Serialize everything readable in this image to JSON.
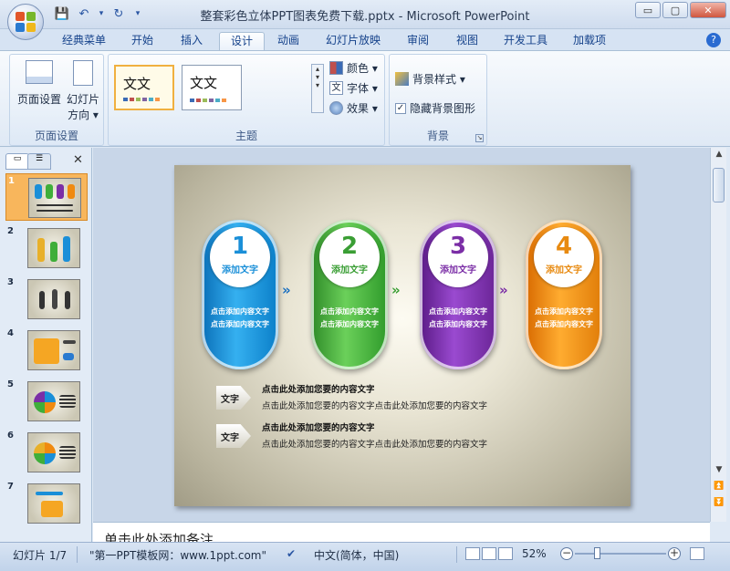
{
  "window": {
    "title": "整套彩色立体PPT图表免费下载.pptx - Microsoft PowerPoint",
    "controls": [
      "▭",
      "▢",
      "✕"
    ]
  },
  "qat": {
    "save": "💾",
    "undo": "↶",
    "undo_arrow": "▾",
    "redo": "↻",
    "custom": "▾"
  },
  "tabs": [
    "经典菜单",
    "开始",
    "插入",
    "设计",
    "动画",
    "幻灯片放映",
    "审阅",
    "视图",
    "开发工具",
    "加载项"
  ],
  "active_tab": "设计",
  "help": "?",
  "ribbon": {
    "page_setup": {
      "page_setup_btn": "页面设置",
      "orientation_btn_l1": "幻灯片",
      "orientation_btn_l2": "方向 ▾",
      "label": "页面设置"
    },
    "themes": {
      "thumb1_text": "文文",
      "thumb2_text": "文文",
      "colors": "颜色 ▾",
      "fonts": "字体 ▾",
      "effects": "效果 ▾",
      "label": "主题"
    },
    "background": {
      "styles": "背景样式 ▾",
      "hide_graphics": "隐藏背景图形",
      "label": "背景"
    }
  },
  "slide_pane": {
    "slides": [
      "1",
      "2",
      "3",
      "4",
      "5",
      "6",
      "7"
    ],
    "active": 1,
    "close": "✕"
  },
  "slide": {
    "steps": [
      {
        "num": "1",
        "label": "添加文字",
        "body1": "点击添加内容文字",
        "body2": "点击添加内容文字",
        "color": "#1a8fd8",
        "num_color": "#1a8fd8"
      },
      {
        "num": "2",
        "label": "添加文字",
        "body1": "点击添加内容文字",
        "body2": "点击添加内容文字",
        "color": "#3fae3a",
        "num_color": "#3a9e34"
      },
      {
        "num": "3",
        "label": "添加文字",
        "body1": "点击添加内容文字",
        "body2": "点击添加内容文字",
        "color": "#7b2ea6",
        "num_color": "#7b2ea6"
      },
      {
        "num": "4",
        "label": "添加文字",
        "body1": "点击添加内容文字",
        "body2": "点击添加内容文字",
        "color": "#f08a10",
        "num_color": "#e88a10"
      }
    ],
    "chevrons": [
      "»",
      "»",
      "»"
    ],
    "bullets": [
      {
        "tag": "文字",
        "title": "点击此处添加您要的内容文字",
        "desc": "点击此处添加您要的内容文字点击此处添加您要的内容文字"
      },
      {
        "tag": "文字",
        "title": "点击此处添加您要的内容文字",
        "desc": "点击此处添加您要的内容文字点击此处添加您要的内容文字"
      }
    ]
  },
  "notes": {
    "placeholder": "单击此处添加备注"
  },
  "status": {
    "slide": "幻灯片 1/7",
    "theme": "\"第一PPT模板网：www.1ppt.com\"",
    "language": "中文(简体，中国)",
    "zoom": "52%",
    "zoom_level": 0.52
  }
}
